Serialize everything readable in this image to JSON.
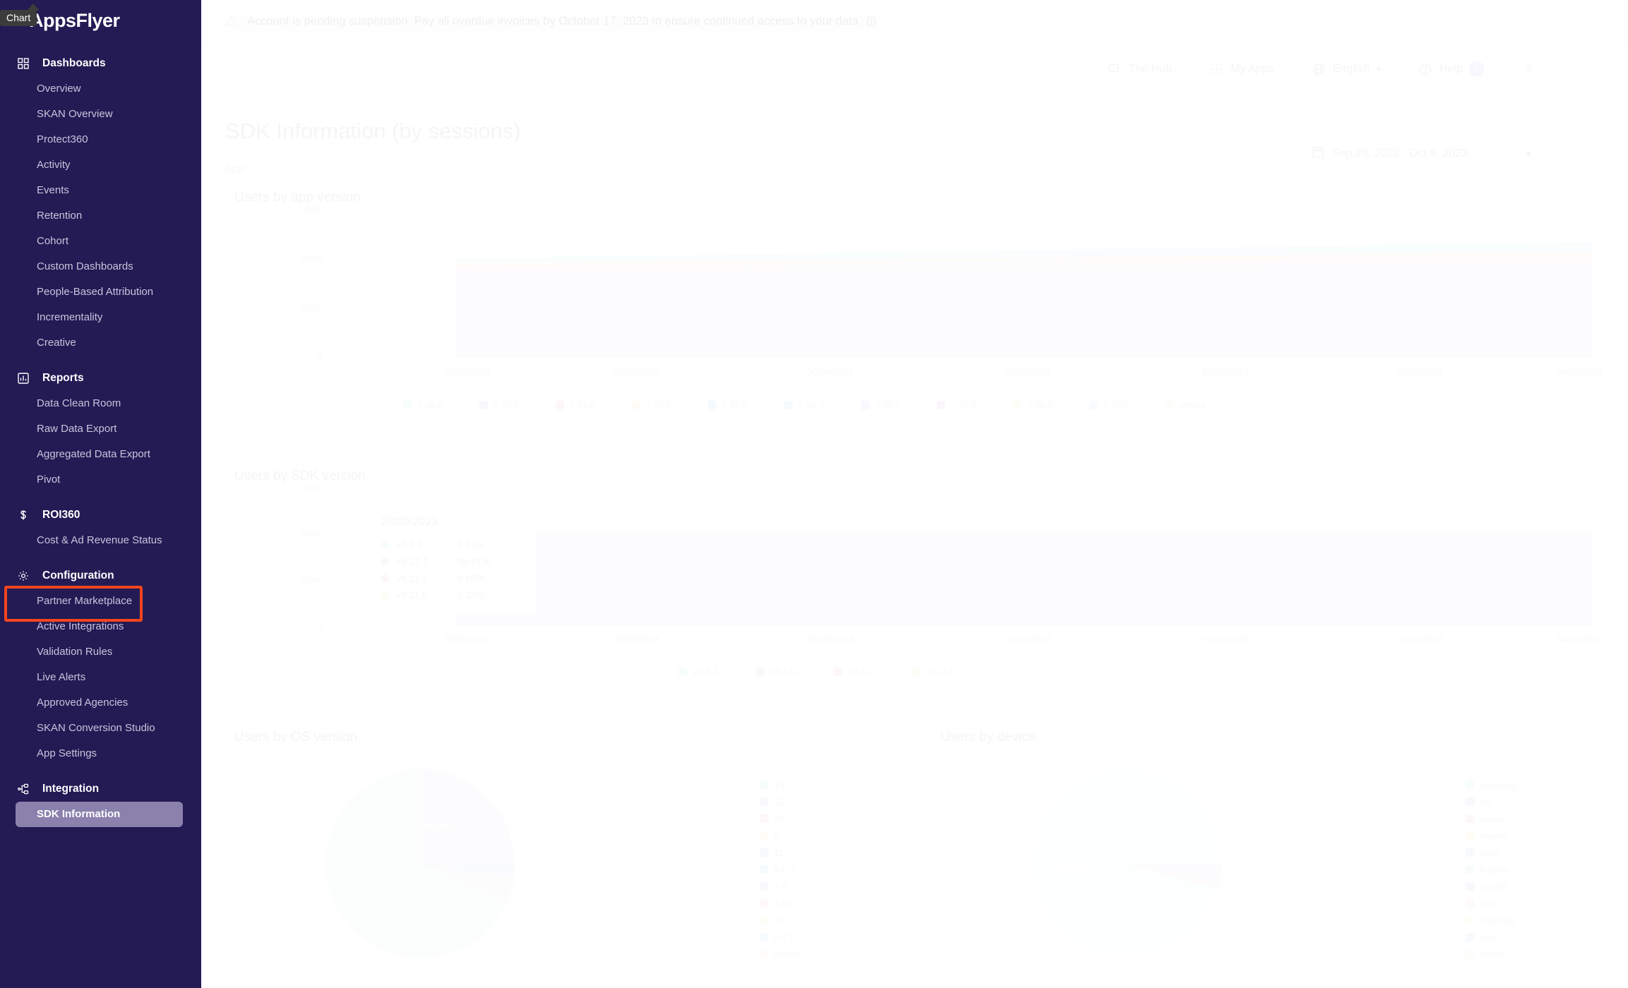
{
  "overlay_badge": {
    "label": "Chart"
  },
  "sidebar": {
    "brand": "AppsFlyer",
    "groups": [
      {
        "label": "Dashboards",
        "icon": "grid-icon",
        "items": [
          {
            "label": "Overview"
          },
          {
            "label": "SKAN Overview"
          },
          {
            "label": "Protect360"
          },
          {
            "label": "Activity"
          },
          {
            "label": "Events"
          },
          {
            "label": "Retention"
          },
          {
            "label": "Cohort"
          },
          {
            "label": "Custom Dashboards"
          },
          {
            "label": "People-Based Attribution"
          },
          {
            "label": "Incrementality"
          },
          {
            "label": "Creative"
          }
        ]
      },
      {
        "label": "Reports",
        "icon": "bar-chart-icon",
        "items": [
          {
            "label": "Data Clean Room"
          },
          {
            "label": "Raw Data Export"
          },
          {
            "label": "Aggregated Data Export"
          },
          {
            "label": "Pivot"
          }
        ]
      },
      {
        "label": "ROI360",
        "icon": "dollar-icon",
        "items": [
          {
            "label": "Cost & Ad Revenue Status"
          }
        ]
      },
      {
        "label": "Configuration",
        "icon": "gear-icon",
        "items": [
          {
            "label": "Partner Marketplace",
            "highlighted": true
          },
          {
            "label": "Active Integrations"
          },
          {
            "label": "Validation Rules"
          },
          {
            "label": "Live Alerts"
          },
          {
            "label": "Approved Agencies"
          },
          {
            "label": "SKAN Conversion Studio"
          },
          {
            "label": "App Settings"
          }
        ]
      },
      {
        "label": "Integration",
        "icon": "integration-icon",
        "items": [
          {
            "label": "SDK Information",
            "active": true
          }
        ]
      }
    ]
  },
  "alert": {
    "text": "Account is pending suspension. Pay all overdue invoices by October 17, 2023 to ensure continued access to your data.",
    "link": "(i)"
  },
  "topnav": {
    "items": [
      {
        "label": "The Hub",
        "icon": "hub-icon"
      },
      {
        "label": "My Apps",
        "icon": "apps-grid-icon"
      },
      {
        "label": "English",
        "icon": "globe-icon",
        "chevron": "▾"
      },
      {
        "label": "Help",
        "icon": "question-circle-icon",
        "badge": "6"
      }
    ],
    "account_icon": "user-icon"
  },
  "page": {
    "title": "SDK Information (by sessions)",
    "filter_label": "App:",
    "filter_value": "",
    "date_range": "Sep 28, 2023 - Oct 5, 2023",
    "calendar_icon": "calendar-icon",
    "chevron_icon": "chevron-down-icon"
  },
  "accent": {
    "sidebar_bg": "#241a54",
    "active_item": "#8a81ad",
    "annotation_box": "#f4451c",
    "brand_purple": "#6f5ce0"
  },
  "chart_data": [
    {
      "id": "users-by-app-version",
      "type": "area",
      "title": "Users by app version",
      "xlabel": "",
      "ylabel": "",
      "ylim": [
        0,
        750000
      ],
      "yticks": [
        "0",
        "250k",
        "500k",
        "750k"
      ],
      "grid": true,
      "legend_position": "bottom",
      "x": [
        "28/09/2023",
        "29/09/2023",
        "30/09/2023",
        "01/10/2023",
        "02/10/2023",
        "03/10/2023",
        "04/10/2023"
      ],
      "series": [
        {
          "name": "7.36.0",
          "color": "#5bc8e0",
          "values": [
            0,
            20000,
            58000,
            96000,
            135000,
            173000,
            210000
          ]
        },
        {
          "name": "7.35.0",
          "color": "#7c6ce0",
          "values": [
            470000,
            462000,
            452000,
            441000,
            430000,
            419000,
            408000
          ]
        },
        {
          "name": "7.34.0",
          "color": "#e05c9e",
          "values": [
            26000,
            25000,
            24000,
            23000,
            22000,
            21000,
            20000
          ]
        },
        {
          "name": "7.33.0",
          "color": "#f0c541",
          "values": [
            9000,
            8700,
            8400,
            8100,
            7800,
            7500,
            7200
          ]
        },
        {
          "name": "7.32.0",
          "color": "#4a9ae8",
          "values": [
            6000,
            5800,
            5600,
            5400,
            5200,
            5000,
            4800
          ]
        },
        {
          "name": "7.31.1",
          "color": "#3fd0d4",
          "values": [
            4000,
            3900,
            3800,
            3700,
            3600,
            3500,
            3400
          ]
        },
        {
          "name": "7.30.0",
          "color": "#8a7ce8",
          "values": [
            3000,
            2900,
            2800,
            2700,
            2600,
            2500,
            2400
          ]
        },
        {
          "name": "7.29.0",
          "color": "#b94fc0",
          "values": [
            2500,
            2400,
            2300,
            2200,
            2100,
            2000,
            1900
          ]
        },
        {
          "name": "7.28.0",
          "color": "#f2e06a",
          "values": [
            2000,
            1950,
            1900,
            1850,
            1800,
            1750,
            1700
          ]
        },
        {
          "name": "7.26.0",
          "color": "#6fb5f5",
          "values": [
            1500,
            1450,
            1400,
            1350,
            1300,
            1250,
            1200
          ]
        },
        {
          "name": "others",
          "color": "#f5e79a",
          "values": [
            4000,
            3900,
            3800,
            3700,
            3600,
            3500,
            3400
          ]
        }
      ]
    },
    {
      "id": "users-by-sdk-version",
      "type": "area",
      "title": "Users by SDK version",
      "xlabel": "",
      "ylabel": "",
      "ylim": [
        0,
        750000
      ],
      "yticks": [
        "0",
        "250k",
        "500k",
        "750k"
      ],
      "grid": true,
      "legend_position": "bottom",
      "x": [
        "28/09/2023",
        "29/09/2023",
        "30/09/2023",
        "01/10/2023",
        "02/10/2023",
        "03/10/2023",
        "04/10/2023"
      ],
      "series": [
        {
          "name": "v6.3.2",
          "color": "#5bc8e0",
          "values": [
            6200,
            6100,
            6000,
            5900,
            5800,
            5700,
            5600
          ]
        },
        {
          "name": "v6.12.1",
          "color": "#7c6ce0",
          "values": [
            504000,
            500000,
            496000,
            492000,
            488000,
            484000,
            480000
          ]
        },
        {
          "name": "v6.11.1",
          "color": "#e05c9e",
          "values": [
            520,
            510,
            500,
            490,
            480,
            470,
            460
          ]
        },
        {
          "name": "v6.11.0",
          "color": "#f0c541",
          "values": [
            1430,
            1410,
            1390,
            1370,
            1350,
            1330,
            1310
          ]
        }
      ],
      "tooltip": {
        "date": "28/09/2023",
        "rows": [
          {
            "name": "v6.3.2",
            "value": "1.21%",
            "color": "#5bc8e0"
          },
          {
            "name": "v6.12.1",
            "value": "98.41%",
            "color": "#7c6ce0"
          },
          {
            "name": "v6.11.1",
            "value": "0.10%",
            "color": "#e05c9e"
          },
          {
            "name": "v6.11.0",
            "value": "0.28%",
            "color": "#f0c541"
          }
        ]
      }
    },
    {
      "id": "users-by-os-version",
      "type": "pie",
      "title": "Users by OS version",
      "legend_position": "right",
      "labels": [
        "13",
        "12",
        "10",
        "9",
        "11",
        "8.0.0",
        "7.0",
        "8.1.0",
        "14",
        "6.0.1",
        "others"
      ],
      "values": [
        74.6,
        14.6,
        4.1,
        2.2,
        1.6,
        1.0,
        0.7,
        0.5,
        0.4,
        0.2,
        0.1
      ],
      "colors": [
        "#5bc8e0",
        "#7c6ce0",
        "#e05c9e",
        "#f0c541",
        "#4a9ae8",
        "#3fd0d4",
        "#8a7ce8",
        "#e88ac0",
        "#f2e06a",
        "#6fb5f5",
        "#f5e79a"
      ],
      "visible_labels": [
        {
          "text": "74.6%",
          "slice": "13"
        },
        {
          "text": "14.6%",
          "slice": "12"
        }
      ]
    },
    {
      "id": "users-by-device",
      "type": "pie",
      "title": "Users by device",
      "legend_position": "right",
      "labels": [
        "samsung",
        "lge",
        "realmi",
        "xiaomi",
        "poco",
        "huawei",
        "google",
        "oppo",
        "motorola",
        "vivo",
        "others"
      ],
      "values": [
        96.7,
        1.2,
        0.7,
        0.4,
        0.3,
        0.25,
        0.18,
        0.12,
        0.07,
        0.04,
        0.04
      ],
      "colors": [
        "#5bc8e0",
        "#7c6ce0",
        "#e05c9e",
        "#f0c541",
        "#4a9ae8",
        "#3fd0d4",
        "#8a7ce8",
        "#e88ac0",
        "#f2e06a",
        "#6fb5f5",
        "#f5e79a"
      ],
      "visible_labels": [
        {
          "text": "96.7%",
          "slice": "samsung"
        }
      ]
    }
  ]
}
